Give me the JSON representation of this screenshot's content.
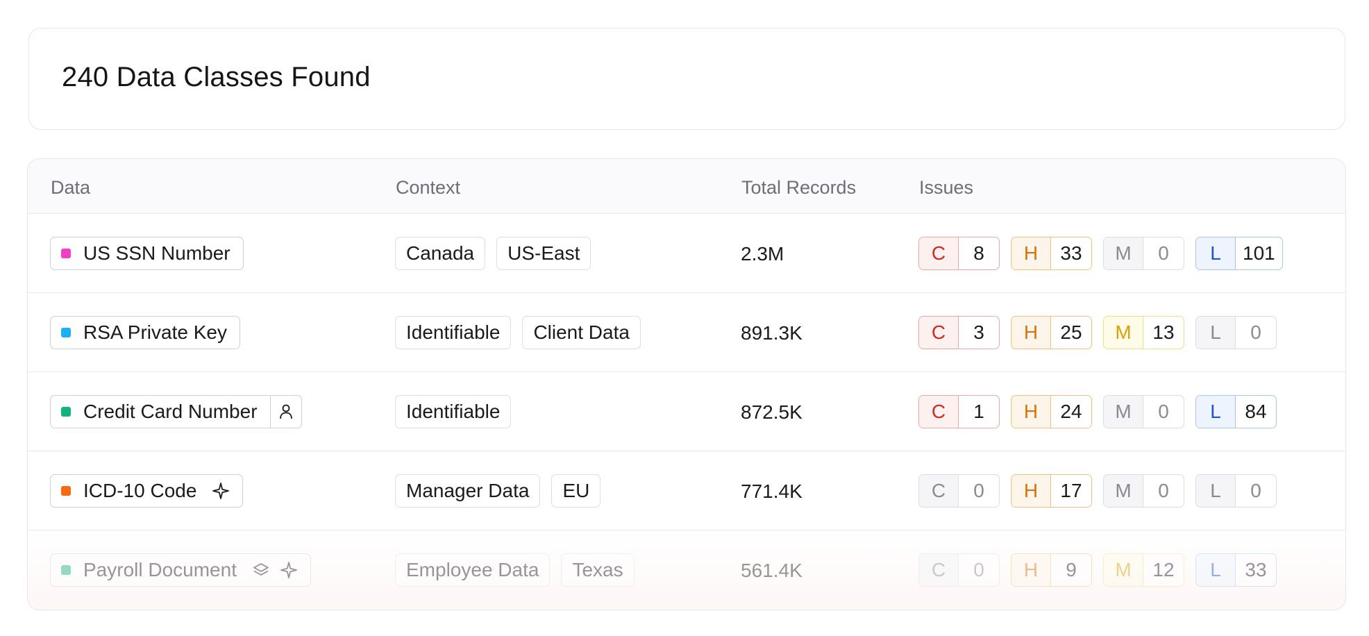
{
  "summary": {
    "title": "240 Data Classes Found"
  },
  "table": {
    "headers": {
      "data": "Data",
      "context": "Context",
      "total_records": "Total Records",
      "issues": "Issues"
    },
    "rows": [
      {
        "name": "US SSN Number",
        "dot_color": "#f03fc5",
        "context": [
          "Canada",
          "US-East"
        ],
        "records": "2.3M",
        "issues": {
          "c": "8",
          "h": "33",
          "m": "0",
          "l": "101"
        }
      },
      {
        "name": "RSA Private Key",
        "dot_color": "#1ab2f5",
        "context": [
          "Identifiable",
          "Client Data"
        ],
        "records": "891.3K",
        "issues": {
          "c": "3",
          "h": "25",
          "m": "13",
          "l": "0"
        }
      },
      {
        "name": "Credit Card Number",
        "dot_color": "#14b37d",
        "icon": "person-icon",
        "context": [
          "Identifiable"
        ],
        "records": "872.5K",
        "issues": {
          "c": "1",
          "h": "24",
          "m": "0",
          "l": "84"
        }
      },
      {
        "name": "ICD-10 Code",
        "dot_color": "#f76a12",
        "icon": "sparkle-icon",
        "context": [
          "Manager Data",
          "EU"
        ],
        "records": "771.4K",
        "issues": {
          "c": "0",
          "h": "17",
          "m": "0",
          "l": "0"
        }
      },
      {
        "name": "Payroll Document",
        "dot_color": "#14b37d",
        "icons": [
          "layers-icon",
          "sparkle-icon"
        ],
        "context": [
          "Employee Data",
          "Texas"
        ],
        "records": "561.4K",
        "issues": {
          "c": "0",
          "h": "9",
          "m": "12",
          "l": "33"
        }
      }
    ]
  },
  "severity_letters": {
    "c": "C",
    "h": "H",
    "m": "M",
    "l": "L"
  }
}
